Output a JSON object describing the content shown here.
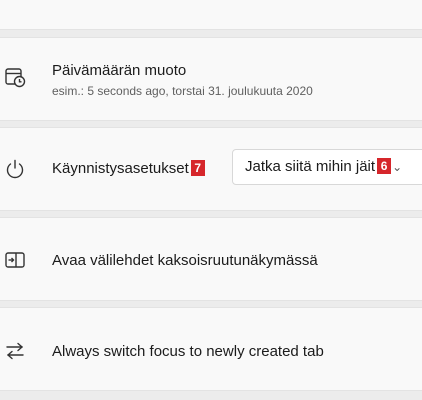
{
  "settings": {
    "date_format": {
      "title": "Päivämäärän muoto",
      "example": "esim.: 5 seconds ago, torstai 31. joulukuuta 2020",
      "icon": "calendar-clock-icon"
    },
    "startup": {
      "title": "Käynnistysasetukset",
      "title_badge": "7",
      "dropdown_value": "Jatka siitä mihin jäit",
      "dropdown_badge": "6",
      "icon": "power-icon"
    },
    "split_pane": {
      "title": "Avaa välilehdet kaksoisruutunäkymässä",
      "icon": "split-pane-icon"
    },
    "focus_new_tab": {
      "title": "Always switch focus to newly created tab",
      "icon": "switch-arrows-icon"
    }
  },
  "colors": {
    "badge": "#d6262b",
    "card": "#f9f9f9",
    "page": "#ececec"
  }
}
